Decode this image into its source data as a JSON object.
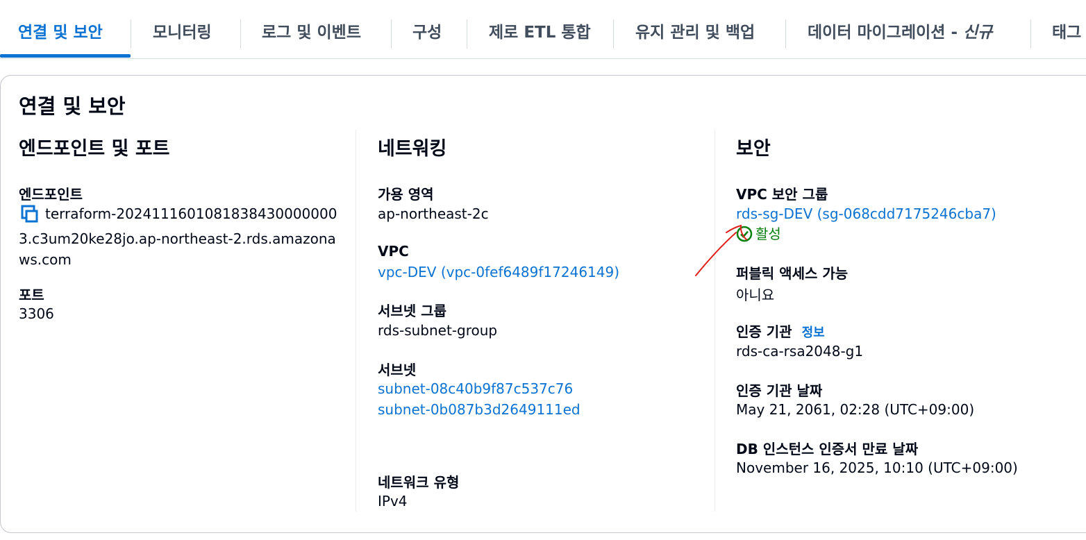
{
  "tabs": [
    {
      "label": "연결 및 보안",
      "active": true
    },
    {
      "label": "모니터링"
    },
    {
      "label": "로그 및 이벤트"
    },
    {
      "label": "구성"
    },
    {
      "label": "제로 ETL 통합"
    },
    {
      "label": "유지 관리 및 백업"
    },
    {
      "label": "데이터 마이그레이션 - ",
      "italic_suffix": "신규"
    },
    {
      "label": "태그"
    }
  ],
  "panel": {
    "title": "연결 및 보안",
    "endpoint_section": {
      "title": "엔드포인트 및 포트",
      "endpoint_label": "엔드포인트",
      "endpoint_value": "terraform-20241116010818384300000003.c3um20ke28jo.ap-northeast-2.rds.amazonaws.com",
      "port_label": "포트",
      "port_value": "3306"
    },
    "network_section": {
      "title": "네트워킹",
      "az_label": "가용 영역",
      "az_value": "ap-northeast-2c",
      "vpc_label": "VPC",
      "vpc_value": "vpc-DEV (vpc-0fef6489f17246149)",
      "subnet_group_label": "서브넷 그룹",
      "subnet_group_value": "rds-subnet-group",
      "subnets_label": "서브넷",
      "subnets": [
        "subnet-08c40b9f87c537c76",
        "subnet-0b087b3d2649111ed"
      ],
      "network_type_label": "네트워크 유형",
      "network_type_value": "IPv4"
    },
    "security_section": {
      "title": "보안",
      "sg_label": "VPC 보안 그룹",
      "sg_value": "rds-sg-DEV (sg-068cdd7175246cba7)",
      "sg_status": "활성",
      "public_label": "퍼블릭 액세스 가능",
      "public_value": "아니요",
      "ca_label": "인증 기관",
      "ca_info": "정보",
      "ca_value": "rds-ca-rsa2048-g1",
      "ca_date_label": "인증 기관 날짜",
      "ca_date_value": "May 21, 2061, 02:28 (UTC+09:00)",
      "cert_expiry_label": "DB 인스턴스 인증서 만료 날짜",
      "cert_expiry_value": "November 16, 2025, 10:10 (UTC+09:00)"
    }
  },
  "colors": {
    "accent": "#0972d3",
    "success": "#037f0c",
    "annotation": "#e0201b"
  }
}
